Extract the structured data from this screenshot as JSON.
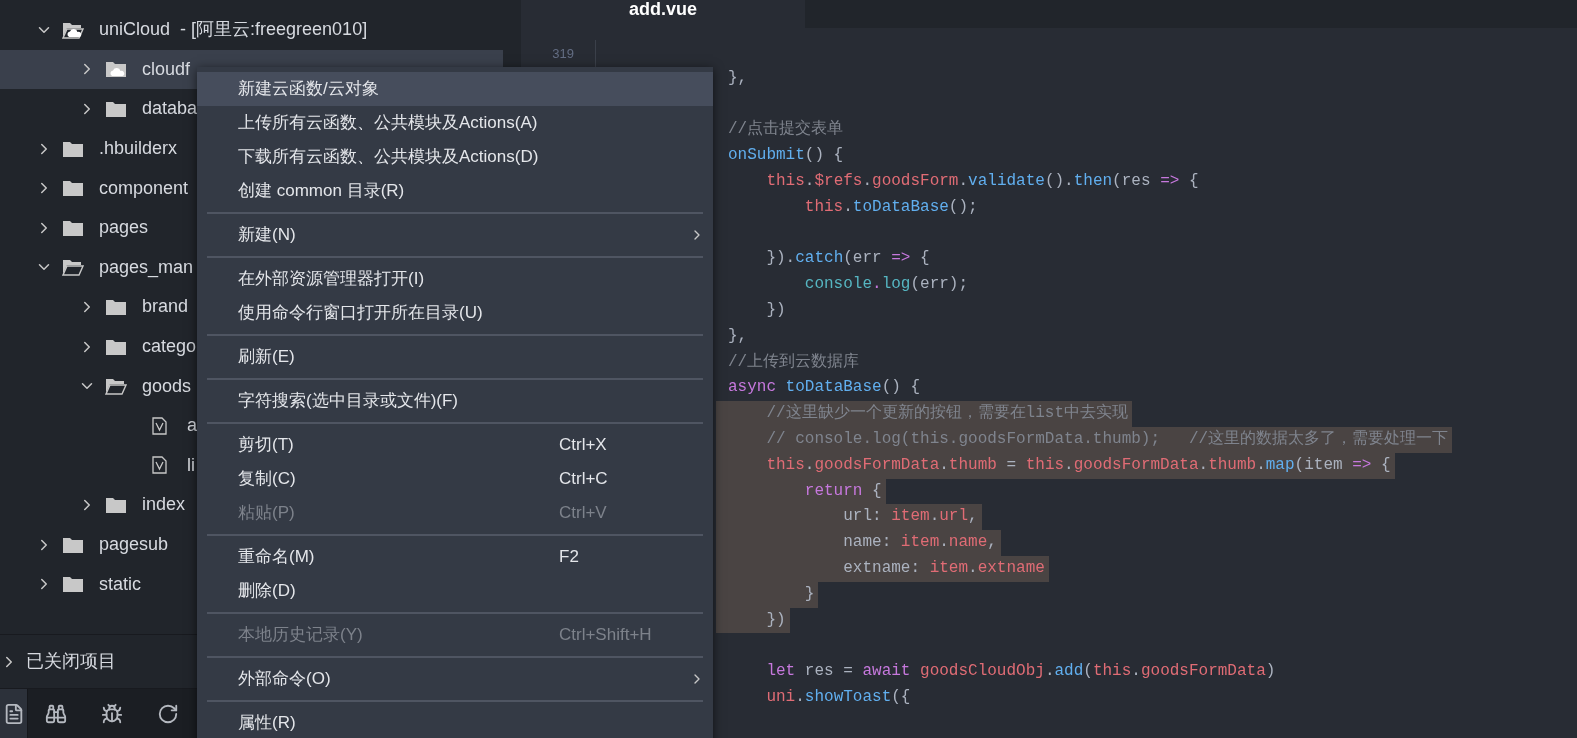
{
  "tree": [
    {
      "kind": "cloud-folder",
      "label": "uniCloud",
      "detail": "- [阿里云:freegreen010]",
      "expanded": true,
      "selected": false,
      "children": [
        {
          "kind": "cloud-folder",
          "label": "cloudf",
          "expanded": false,
          "selected": true
        },
        {
          "kind": "folder",
          "label": "databa",
          "expanded": false,
          "selected": false
        }
      ]
    },
    {
      "kind": "folder",
      "label": ".hbuilderx",
      "expanded": false,
      "selected": false
    },
    {
      "kind": "folder",
      "label": "component",
      "expanded": false,
      "selected": false
    },
    {
      "kind": "folder",
      "label": "pages",
      "expanded": false,
      "selected": false
    },
    {
      "kind": "folder",
      "label": "pages_man",
      "expanded": true,
      "selected": false,
      "children": [
        {
          "kind": "folder",
          "label": "brand",
          "expanded": false,
          "selected": false
        },
        {
          "kind": "folder",
          "label": "catego",
          "expanded": false,
          "selected": false
        },
        {
          "kind": "folder",
          "label": "goods",
          "expanded": true,
          "selected": false,
          "children": [
            {
              "kind": "file",
              "label": "a",
              "selected": false
            },
            {
              "kind": "file",
              "label": "li",
              "selected": false
            }
          ]
        },
        {
          "kind": "folder",
          "label": "index",
          "expanded": false,
          "selected": false
        }
      ]
    },
    {
      "kind": "folder",
      "label": "pagesub",
      "expanded": false,
      "selected": false
    },
    {
      "kind": "folder",
      "label": "static",
      "expanded": false,
      "selected": false
    }
  ],
  "closed_projects": {
    "label": "已关闭项目",
    "expanded": false
  },
  "toolbar": [
    {
      "kind": "files",
      "selected": true
    },
    {
      "kind": "search",
      "selected": false
    },
    {
      "kind": "debug",
      "selected": false
    },
    {
      "kind": "sync",
      "selected": false
    }
  ],
  "editor": {
    "tab": "add.vue",
    "line_number": "319",
    "lines": [
      {
        "selected": false
      },
      {
        "selected": false,
        "tokens": [
          {
            "text": "},",
            "kind": "plain"
          }
        ]
      },
      {
        "selected": false
      },
      {
        "selected": false,
        "tokens": [
          {
            "text": "//点击提交表单",
            "kind": "comment"
          }
        ]
      },
      {
        "selected": false,
        "tokens": [
          {
            "text": "onSubmit",
            "kind": "function"
          },
          {
            "text": "() {",
            "kind": "plain"
          }
        ]
      },
      {
        "selected": false,
        "tokens": [
          {
            "text": "    this",
            "kind": "property"
          },
          {
            "text": ".",
            "kind": "plain"
          },
          {
            "text": "$refs",
            "kind": "property"
          },
          {
            "text": ".",
            "kind": "plain"
          },
          {
            "text": "goodsForm",
            "kind": "property"
          },
          {
            "text": ".",
            "kind": "plain"
          },
          {
            "text": "validate",
            "kind": "function"
          },
          {
            "text": "().",
            "kind": "plain"
          },
          {
            "text": "then",
            "kind": "function"
          },
          {
            "text": "(res ",
            "kind": "plain"
          },
          {
            "text": "=>",
            "kind": "keyword"
          },
          {
            "text": " {",
            "kind": "plain"
          }
        ]
      },
      {
        "selected": false,
        "tokens": [
          {
            "text": "        this",
            "kind": "property"
          },
          {
            "text": ".",
            "kind": "plain"
          },
          {
            "text": "toDataBase",
            "kind": "function"
          },
          {
            "text": "();",
            "kind": "plain"
          }
        ]
      },
      {
        "selected": false
      },
      {
        "selected": false,
        "tokens": [
          {
            "text": "    }).",
            "kind": "plain"
          },
          {
            "text": "catch",
            "kind": "function"
          },
          {
            "text": "(err ",
            "kind": "plain"
          },
          {
            "text": "=>",
            "kind": "keyword"
          },
          {
            "text": " {",
            "kind": "plain"
          }
        ]
      },
      {
        "selected": false,
        "tokens": [
          {
            "text": "        console",
            "kind": "builtin"
          },
          {
            "text": ".",
            "kind": "keyword"
          },
          {
            "text": "log",
            "kind": "builtin"
          },
          {
            "text": "(err);",
            "kind": "plain"
          }
        ]
      },
      {
        "selected": false,
        "tokens": [
          {
            "text": "    })",
            "kind": "plain"
          }
        ]
      },
      {
        "selected": false,
        "tokens": [
          {
            "text": "},",
            "kind": "plain"
          }
        ]
      },
      {
        "selected": false,
        "tokens": [
          {
            "text": "//上传到云数据库",
            "kind": "comment"
          }
        ]
      },
      {
        "selected": false,
        "tokens": [
          {
            "text": "async",
            "kind": "keyword"
          },
          {
            "text": " toDataBase",
            "kind": "function"
          },
          {
            "text": "() {",
            "kind": "plain"
          }
        ]
      },
      {
        "selected": true,
        "tokens": [
          {
            "text": "    //这里缺少一个更新的按钮，需要在list中去实现",
            "kind": "comment"
          }
        ]
      },
      {
        "selected": true,
        "tokens": [
          {
            "text": "    // console.log(this.goodsFormData.thumb);   //这里的数据太多了，需要处理一下",
            "kind": "comment"
          }
        ]
      },
      {
        "selected": true,
        "tokens": [
          {
            "text": "    this",
            "kind": "property"
          },
          {
            "text": ".",
            "kind": "plain"
          },
          {
            "text": "goodsFormData",
            "kind": "property"
          },
          {
            "text": ".",
            "kind": "plain"
          },
          {
            "text": "thumb",
            "kind": "property"
          },
          {
            "text": " = ",
            "kind": "plain"
          },
          {
            "text": "this",
            "kind": "property"
          },
          {
            "text": ".",
            "kind": "plain"
          },
          {
            "text": "goodsFormData",
            "kind": "property"
          },
          {
            "text": ".",
            "kind": "plain"
          },
          {
            "text": "thumb",
            "kind": "property"
          },
          {
            "text": ".",
            "kind": "plain"
          },
          {
            "text": "map",
            "kind": "function"
          },
          {
            "text": "(item ",
            "kind": "plain"
          },
          {
            "text": "=>",
            "kind": "keyword"
          },
          {
            "text": " {",
            "kind": "plain"
          }
        ]
      },
      {
        "selected": true,
        "tokens": [
          {
            "text": "        return",
            "kind": "keyword"
          },
          {
            "text": " {",
            "kind": "plain"
          }
        ]
      },
      {
        "selected": true,
        "tokens": [
          {
            "text": "            url: ",
            "kind": "plain"
          },
          {
            "text": "item",
            "kind": "property"
          },
          {
            "text": ".",
            "kind": "plain"
          },
          {
            "text": "url",
            "kind": "property"
          },
          {
            "text": ",",
            "kind": "plain"
          }
        ]
      },
      {
        "selected": true,
        "tokens": [
          {
            "text": "            name: ",
            "kind": "plain"
          },
          {
            "text": "item",
            "kind": "property"
          },
          {
            "text": ".",
            "kind": "plain"
          },
          {
            "text": "name",
            "kind": "property"
          },
          {
            "text": ",",
            "kind": "plain"
          }
        ]
      },
      {
        "selected": true,
        "tokens": [
          {
            "text": "            extname: ",
            "kind": "plain"
          },
          {
            "text": "item",
            "kind": "property"
          },
          {
            "text": ".",
            "kind": "plain"
          },
          {
            "text": "extname",
            "kind": "property"
          }
        ]
      },
      {
        "selected": true,
        "tokens": [
          {
            "text": "        }",
            "kind": "plain"
          }
        ]
      },
      {
        "selected": true,
        "tokens": [
          {
            "text": "    })",
            "kind": "plain"
          }
        ]
      },
      {
        "selected": false
      },
      {
        "selected": false,
        "tokens": [
          {
            "text": "    let",
            "kind": "keyword"
          },
          {
            "text": " res = ",
            "kind": "plain"
          },
          {
            "text": "await",
            "kind": "keyword"
          },
          {
            "text": " goodsCloudObj",
            "kind": "property"
          },
          {
            "text": ".",
            "kind": "plain"
          },
          {
            "text": "add",
            "kind": "function"
          },
          {
            "text": "(",
            "kind": "plain"
          },
          {
            "text": "this",
            "kind": "property"
          },
          {
            "text": ".",
            "kind": "plain"
          },
          {
            "text": "goodsFormData",
            "kind": "property"
          },
          {
            "text": ")",
            "kind": "plain"
          }
        ]
      },
      {
        "selected": false,
        "tokens": [
          {
            "text": "    uni",
            "kind": "property"
          },
          {
            "text": ".",
            "kind": "plain"
          },
          {
            "text": "showToast",
            "kind": "function"
          },
          {
            "text": "({",
            "kind": "plain"
          }
        ]
      }
    ]
  },
  "context_menu": [
    {
      "kind": "item",
      "label": "新建云函数/云对象",
      "selected": true,
      "disabled": false,
      "submenu": false
    },
    {
      "kind": "item",
      "label": "上传所有云函数、公共模块及Actions(A)",
      "selected": false,
      "disabled": false,
      "submenu": false
    },
    {
      "kind": "item",
      "label": "下载所有云函数、公共模块及Actions(D)",
      "selected": false,
      "disabled": false,
      "submenu": false
    },
    {
      "kind": "item",
      "label": "创建 common 目录(R)",
      "selected": false,
      "disabled": false,
      "submenu": false
    },
    {
      "kind": "separator"
    },
    {
      "kind": "item",
      "label": "新建(N)",
      "selected": false,
      "disabled": false,
      "submenu": true
    },
    {
      "kind": "separator"
    },
    {
      "kind": "item",
      "label": "在外部资源管理器打开(I)",
      "selected": false,
      "disabled": false,
      "submenu": false
    },
    {
      "kind": "item",
      "label": "使用命令行窗口打开所在目录(U)",
      "selected": false,
      "disabled": false,
      "submenu": false
    },
    {
      "kind": "separator"
    },
    {
      "kind": "item",
      "label": "刷新(E)",
      "selected": false,
      "disabled": false,
      "submenu": false
    },
    {
      "kind": "separator"
    },
    {
      "kind": "item",
      "label": "字符搜索(选中目录或文件)(F)",
      "selected": false,
      "disabled": false,
      "submenu": false
    },
    {
      "kind": "separator"
    },
    {
      "kind": "item",
      "label": "剪切(T)",
      "shortcut": "Ctrl+X",
      "selected": false,
      "disabled": false,
      "submenu": false
    },
    {
      "kind": "item",
      "label": "复制(C)",
      "shortcut": "Ctrl+C",
      "selected": false,
      "disabled": false,
      "submenu": false
    },
    {
      "kind": "item",
      "label": "粘贴(P)",
      "shortcut": "Ctrl+V",
      "selected": false,
      "disabled": true,
      "submenu": false
    },
    {
      "kind": "separator"
    },
    {
      "kind": "item",
      "label": "重命名(M)",
      "shortcut": "F2",
      "selected": false,
      "disabled": false,
      "submenu": false
    },
    {
      "kind": "item",
      "label": "删除(D)",
      "selected": false,
      "disabled": false,
      "submenu": false
    },
    {
      "kind": "separator"
    },
    {
      "kind": "item",
      "label": "本地历史记录(Y)",
      "shortcut": "Ctrl+Shift+H",
      "selected": false,
      "disabled": true,
      "submenu": false
    },
    {
      "kind": "separator"
    },
    {
      "kind": "item",
      "label": "外部命令(O)",
      "selected": false,
      "disabled": false,
      "submenu": true
    },
    {
      "kind": "separator"
    },
    {
      "kind": "item",
      "label": "属性(R)",
      "selected": false,
      "disabled": false,
      "submenu": false
    }
  ]
}
